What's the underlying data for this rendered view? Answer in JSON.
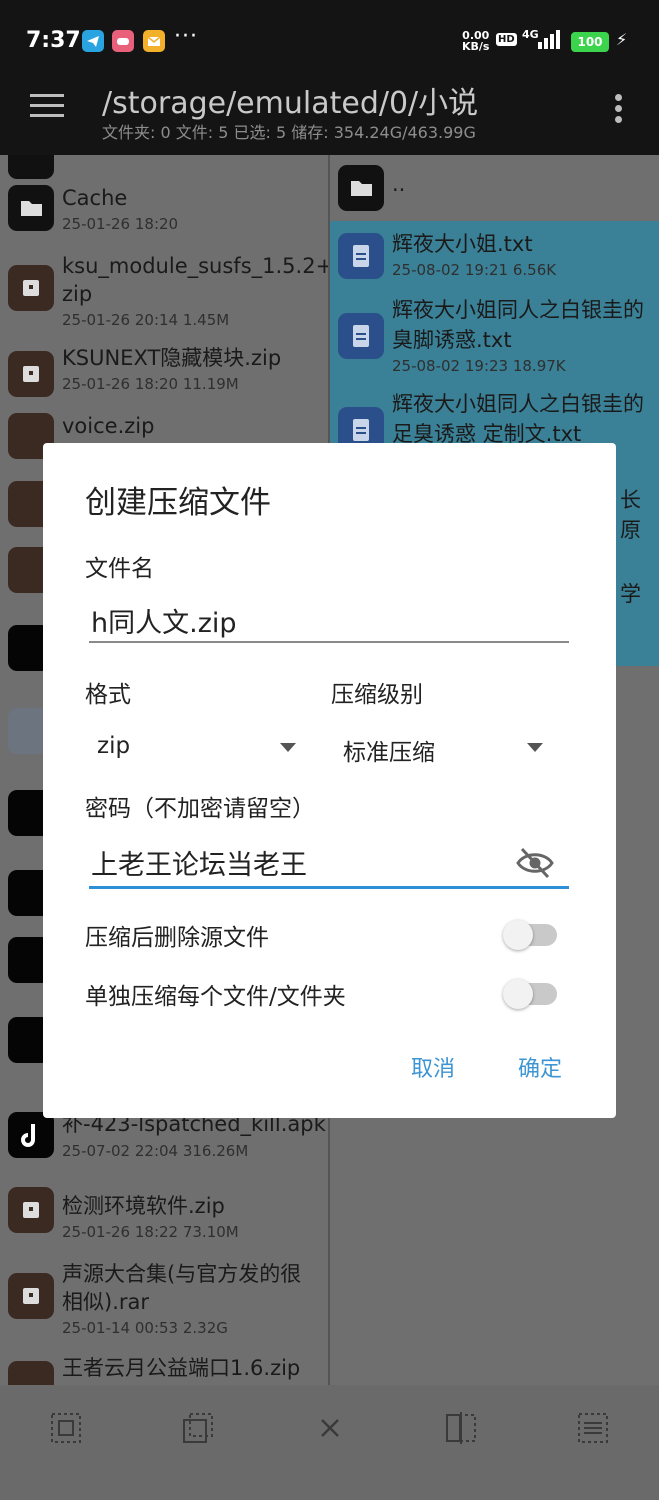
{
  "status_bar": {
    "time": "7:37",
    "more": "···",
    "net_speed": "0.00",
    "net_unit": "KB/s",
    "hd": "HD",
    "network": "4G",
    "battery": "100"
  },
  "app_bar": {
    "path": "/storage/emulated/0/小说",
    "info": "文件夹: 0  文件: 5  已选: 5  储存: 354.24G/463.99G"
  },
  "left_pane": {
    "items": [
      {
        "name": "Cache",
        "meta": "25-01-26 18:20"
      },
      {
        "name": "ksu_module_susfs_1.5.2+.",
        "name2": "zip",
        "meta": "25-01-26 20:14  1.45M"
      },
      {
        "name": "KSUNEXT隐藏模块.zip",
        "meta": "25-01-26 18:20  11.19M"
      },
      {
        "name": "voice.zip",
        "meta": ""
      },
      {
        "name": "补-423-lspatched_kill.apk",
        "meta": "25-07-02 22:04  316.26M"
      },
      {
        "name": "检测环境软件.zip",
        "meta": "25-01-26 18:22  73.10M"
      },
      {
        "name": "声源大合集(与官方发的很",
        "name2": "相似).rar",
        "meta": "25-01-14 00:53  2.32G"
      },
      {
        "name": "王者云月公益端口1.6.zip",
        "meta": ""
      }
    ]
  },
  "right_pane": {
    "parent": "..",
    "items": [
      {
        "name": "辉夜大小姐.txt",
        "meta": "25-08-02 19:21  6.56K"
      },
      {
        "name": "辉夜大小姐同人之白银圭的",
        "name2": "臭脚诱惑.txt",
        "meta": "25-08-02 19:23  18.97K"
      },
      {
        "name": "辉夜大小姐同人之白银圭的",
        "name2": "足臭诱惑 定制文.txt",
        "meta": ""
      }
    ],
    "peek1": "长原",
    "peek2": "学"
  },
  "dialog": {
    "title": "创建压缩文件",
    "filename_label": "文件名",
    "filename_value": "h同人文.zip",
    "format_label": "格式",
    "format_value": "zip",
    "level_label": "压缩级别",
    "level_value": "标准压缩",
    "password_label": "密码（不加密请留空）",
    "password_value": "上老王论坛当老王",
    "delete_after_label": "压缩后删除源文件",
    "delete_after_on": false,
    "separate_label": "单独压缩每个文件/文件夹",
    "separate_on": false,
    "cancel_label": "取消",
    "confirm_label": "确定"
  }
}
